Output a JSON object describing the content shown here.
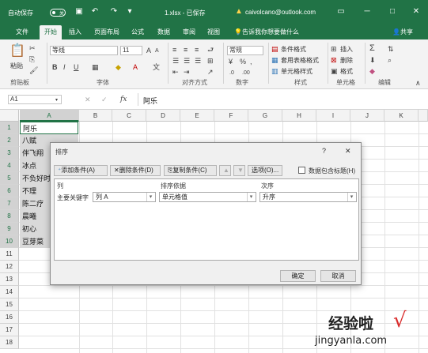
{
  "titlebar": {
    "autosave_label": "自动保存",
    "autosave_state": "关",
    "filename": "1.xlsx - 已保存",
    "warning": "caivolcano@outlook.com"
  },
  "tabs": [
    "文件",
    "开始",
    "插入",
    "页面布局",
    "公式",
    "数据",
    "审阅",
    "视图"
  ],
  "tell_me": "告诉我你想要做什么",
  "share": "共享",
  "ribbon": {
    "paste": "粘贴",
    "font_name": "等线",
    "font_size": "11",
    "number_format": "常规",
    "cond_format": "条件格式",
    "table_format": "套用表格格式",
    "cell_style": "单元格样式",
    "insert": "插入",
    "delete": "删除",
    "format": "格式",
    "groups": {
      "clipboard": "剪贴板",
      "font": "字体",
      "alignment": "对齐方式",
      "number": "数字",
      "styles": "样式",
      "cells": "单元格",
      "editing": "编辑"
    }
  },
  "formula_bar": {
    "name_box": "A1",
    "fx": "fx",
    "content": "阿乐"
  },
  "columns": [
    "A",
    "B",
    "C",
    "D",
    "E",
    "F",
    "G",
    "H",
    "I",
    "J",
    "K"
  ],
  "rows": [
    "1",
    "2",
    "3",
    "4",
    "5",
    "6",
    "7",
    "8",
    "9",
    "10",
    "11",
    "12",
    "13",
    "14",
    "15",
    "16",
    "17",
    "18"
  ],
  "cells_a": [
    "阿乐",
    "八赋",
    "伴飞翔",
    "冰点",
    "不负好时",
    "不理",
    "陈二疗",
    "晨曦",
    "初心",
    "豆芽菜"
  ],
  "dialog": {
    "title": "排序",
    "help": "?",
    "close": "✕",
    "add_level": "添加条件(A)",
    "delete_level": "删除条件(D)",
    "copy_level": "复制条件(C)",
    "options": "选项(O)...",
    "has_header": "数据包含标题(H)",
    "col_header_column": "列",
    "col_header_sorton": "排序依据",
    "col_header_order": "次序",
    "primary_key": "主要关键字",
    "column_value": "列 A",
    "sorton_value": "单元格值",
    "order_value": "升序",
    "ok": "确定",
    "cancel": "取消"
  },
  "watermark": {
    "brand": "经验啦",
    "url": "jingyanla.com",
    "check": "√"
  }
}
